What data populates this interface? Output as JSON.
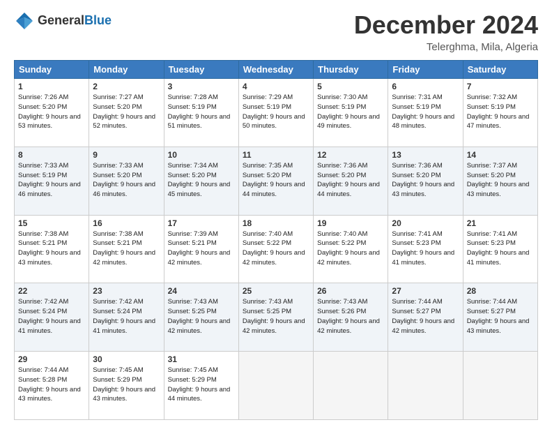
{
  "header": {
    "logo_general": "General",
    "logo_blue": "Blue",
    "month": "December 2024",
    "location": "Telerghma, Mila, Algeria"
  },
  "weekdays": [
    "Sunday",
    "Monday",
    "Tuesday",
    "Wednesday",
    "Thursday",
    "Friday",
    "Saturday"
  ],
  "weeks": [
    [
      {
        "day": 1,
        "sunrise": "7:26 AM",
        "sunset": "5:20 PM",
        "daylight": "9 hours and 53 minutes."
      },
      {
        "day": 2,
        "sunrise": "7:27 AM",
        "sunset": "5:20 PM",
        "daylight": "9 hours and 52 minutes."
      },
      {
        "day": 3,
        "sunrise": "7:28 AM",
        "sunset": "5:19 PM",
        "daylight": "9 hours and 51 minutes."
      },
      {
        "day": 4,
        "sunrise": "7:29 AM",
        "sunset": "5:19 PM",
        "daylight": "9 hours and 50 minutes."
      },
      {
        "day": 5,
        "sunrise": "7:30 AM",
        "sunset": "5:19 PM",
        "daylight": "9 hours and 49 minutes."
      },
      {
        "day": 6,
        "sunrise": "7:31 AM",
        "sunset": "5:19 PM",
        "daylight": "9 hours and 48 minutes."
      },
      {
        "day": 7,
        "sunrise": "7:32 AM",
        "sunset": "5:19 PM",
        "daylight": "9 hours and 47 minutes."
      }
    ],
    [
      {
        "day": 8,
        "sunrise": "7:33 AM",
        "sunset": "5:19 PM",
        "daylight": "9 hours and 46 minutes."
      },
      {
        "day": 9,
        "sunrise": "7:33 AM",
        "sunset": "5:20 PM",
        "daylight": "9 hours and 46 minutes."
      },
      {
        "day": 10,
        "sunrise": "7:34 AM",
        "sunset": "5:20 PM",
        "daylight": "9 hours and 45 minutes."
      },
      {
        "day": 11,
        "sunrise": "7:35 AM",
        "sunset": "5:20 PM",
        "daylight": "9 hours and 44 minutes."
      },
      {
        "day": 12,
        "sunrise": "7:36 AM",
        "sunset": "5:20 PM",
        "daylight": "9 hours and 44 minutes."
      },
      {
        "day": 13,
        "sunrise": "7:36 AM",
        "sunset": "5:20 PM",
        "daylight": "9 hours and 43 minutes."
      },
      {
        "day": 14,
        "sunrise": "7:37 AM",
        "sunset": "5:20 PM",
        "daylight": "9 hours and 43 minutes."
      }
    ],
    [
      {
        "day": 15,
        "sunrise": "7:38 AM",
        "sunset": "5:21 PM",
        "daylight": "9 hours and 43 minutes."
      },
      {
        "day": 16,
        "sunrise": "7:38 AM",
        "sunset": "5:21 PM",
        "daylight": "9 hours and 42 minutes."
      },
      {
        "day": 17,
        "sunrise": "7:39 AM",
        "sunset": "5:21 PM",
        "daylight": "9 hours and 42 minutes."
      },
      {
        "day": 18,
        "sunrise": "7:40 AM",
        "sunset": "5:22 PM",
        "daylight": "9 hours and 42 minutes."
      },
      {
        "day": 19,
        "sunrise": "7:40 AM",
        "sunset": "5:22 PM",
        "daylight": "9 hours and 42 minutes."
      },
      {
        "day": 20,
        "sunrise": "7:41 AM",
        "sunset": "5:23 PM",
        "daylight": "9 hours and 41 minutes."
      },
      {
        "day": 21,
        "sunrise": "7:41 AM",
        "sunset": "5:23 PM",
        "daylight": "9 hours and 41 minutes."
      }
    ],
    [
      {
        "day": 22,
        "sunrise": "7:42 AM",
        "sunset": "5:24 PM",
        "daylight": "9 hours and 41 minutes."
      },
      {
        "day": 23,
        "sunrise": "7:42 AM",
        "sunset": "5:24 PM",
        "daylight": "9 hours and 41 minutes."
      },
      {
        "day": 24,
        "sunrise": "7:43 AM",
        "sunset": "5:25 PM",
        "daylight": "9 hours and 42 minutes."
      },
      {
        "day": 25,
        "sunrise": "7:43 AM",
        "sunset": "5:25 PM",
        "daylight": "9 hours and 42 minutes."
      },
      {
        "day": 26,
        "sunrise": "7:43 AM",
        "sunset": "5:26 PM",
        "daylight": "9 hours and 42 minutes."
      },
      {
        "day": 27,
        "sunrise": "7:44 AM",
        "sunset": "5:27 PM",
        "daylight": "9 hours and 42 minutes."
      },
      {
        "day": 28,
        "sunrise": "7:44 AM",
        "sunset": "5:27 PM",
        "daylight": "9 hours and 43 minutes."
      }
    ],
    [
      {
        "day": 29,
        "sunrise": "7:44 AM",
        "sunset": "5:28 PM",
        "daylight": "9 hours and 43 minutes."
      },
      {
        "day": 30,
        "sunrise": "7:45 AM",
        "sunset": "5:29 PM",
        "daylight": "9 hours and 43 minutes."
      },
      {
        "day": 31,
        "sunrise": "7:45 AM",
        "sunset": "5:29 PM",
        "daylight": "9 hours and 44 minutes."
      },
      null,
      null,
      null,
      null
    ]
  ]
}
